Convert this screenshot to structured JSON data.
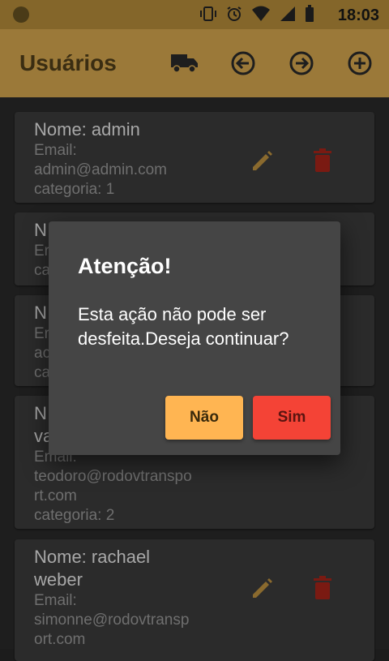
{
  "status_bar": {
    "time": "18:03"
  },
  "app_bar": {
    "title": "Usuários",
    "icons": [
      "truck-icon",
      "arrow-left-circle-icon",
      "arrow-right-circle-icon",
      "plus-circle-icon"
    ]
  },
  "users": [
    {
      "name": "Nome: admin",
      "email_label": "Email:",
      "email_lines": [
        "admin@admin.com"
      ],
      "category": "categoria: 1"
    },
    {
      "name": "N",
      "email_label": "Er",
      "email_lines": [],
      "category": "ca"
    },
    {
      "name": "N",
      "email_label": "Er",
      "email_lines": [
        "ac"
      ],
      "category": "ca"
    },
    {
      "name_lines": [
        "N",
        "va"
      ],
      "email_label": "Email:",
      "email_lines": [
        "teodoro@rodovtranspo",
        "rt.com"
      ],
      "category": "categoria: 2"
    },
    {
      "name_lines": [
        "Nome: rachael",
        "weber"
      ],
      "email_label": "Email:",
      "email_lines": [
        "simonne@rodovtransp",
        "ort.com"
      ]
    }
  ],
  "dialog": {
    "title": "Atenção!",
    "message": "Esta ação não pode ser desfeita.Deseja continuar?",
    "cancel_label": "Não",
    "confirm_label": "Sim"
  },
  "colors": {
    "app_bar": "#9b7939",
    "edit_icon": "#8a6a2e",
    "delete_icon": "#7a1a12",
    "cancel_button": "#ffb552",
    "confirm_button": "#f44336"
  }
}
